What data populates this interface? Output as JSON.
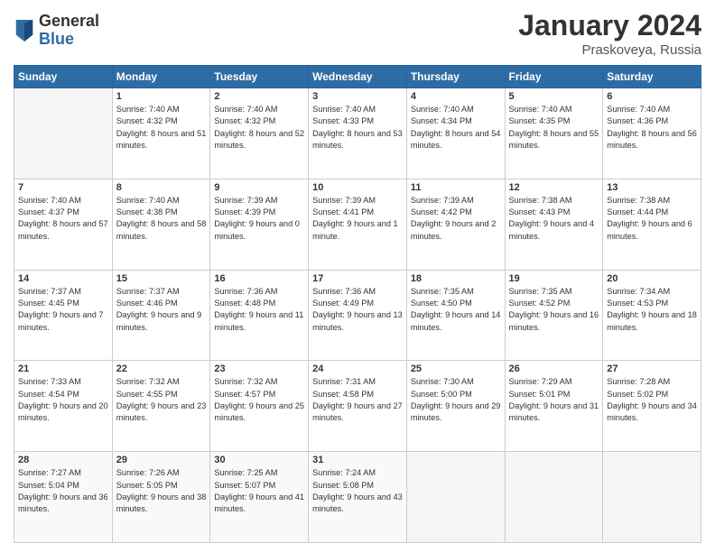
{
  "header": {
    "logo": {
      "general": "General",
      "blue": "Blue"
    },
    "title": "January 2024",
    "location": "Praskoveya, Russia"
  },
  "weekdays": [
    "Sunday",
    "Monday",
    "Tuesday",
    "Wednesday",
    "Thursday",
    "Friday",
    "Saturday"
  ],
  "weeks": [
    [
      {
        "day": "",
        "empty": true
      },
      {
        "day": "1",
        "sunrise": "Sunrise: 7:40 AM",
        "sunset": "Sunset: 4:32 PM",
        "daylight": "Daylight: 8 hours and 51 minutes."
      },
      {
        "day": "2",
        "sunrise": "Sunrise: 7:40 AM",
        "sunset": "Sunset: 4:32 PM",
        "daylight": "Daylight: 8 hours and 52 minutes."
      },
      {
        "day": "3",
        "sunrise": "Sunrise: 7:40 AM",
        "sunset": "Sunset: 4:33 PM",
        "daylight": "Daylight: 8 hours and 53 minutes."
      },
      {
        "day": "4",
        "sunrise": "Sunrise: 7:40 AM",
        "sunset": "Sunset: 4:34 PM",
        "daylight": "Daylight: 8 hours and 54 minutes."
      },
      {
        "day": "5",
        "sunrise": "Sunrise: 7:40 AM",
        "sunset": "Sunset: 4:35 PM",
        "daylight": "Daylight: 8 hours and 55 minutes."
      },
      {
        "day": "6",
        "sunrise": "Sunrise: 7:40 AM",
        "sunset": "Sunset: 4:36 PM",
        "daylight": "Daylight: 8 hours and 56 minutes."
      }
    ],
    [
      {
        "day": "7",
        "sunrise": "Sunrise: 7:40 AM",
        "sunset": "Sunset: 4:37 PM",
        "daylight": "Daylight: 8 hours and 57 minutes."
      },
      {
        "day": "8",
        "sunrise": "Sunrise: 7:40 AM",
        "sunset": "Sunset: 4:38 PM",
        "daylight": "Daylight: 8 hours and 58 minutes."
      },
      {
        "day": "9",
        "sunrise": "Sunrise: 7:39 AM",
        "sunset": "Sunset: 4:39 PM",
        "daylight": "Daylight: 9 hours and 0 minutes."
      },
      {
        "day": "10",
        "sunrise": "Sunrise: 7:39 AM",
        "sunset": "Sunset: 4:41 PM",
        "daylight": "Daylight: 9 hours and 1 minute."
      },
      {
        "day": "11",
        "sunrise": "Sunrise: 7:39 AM",
        "sunset": "Sunset: 4:42 PM",
        "daylight": "Daylight: 9 hours and 2 minutes."
      },
      {
        "day": "12",
        "sunrise": "Sunrise: 7:38 AM",
        "sunset": "Sunset: 4:43 PM",
        "daylight": "Daylight: 9 hours and 4 minutes."
      },
      {
        "day": "13",
        "sunrise": "Sunrise: 7:38 AM",
        "sunset": "Sunset: 4:44 PM",
        "daylight": "Daylight: 9 hours and 6 minutes."
      }
    ],
    [
      {
        "day": "14",
        "sunrise": "Sunrise: 7:37 AM",
        "sunset": "Sunset: 4:45 PM",
        "daylight": "Daylight: 9 hours and 7 minutes."
      },
      {
        "day": "15",
        "sunrise": "Sunrise: 7:37 AM",
        "sunset": "Sunset: 4:46 PM",
        "daylight": "Daylight: 9 hours and 9 minutes."
      },
      {
        "day": "16",
        "sunrise": "Sunrise: 7:36 AM",
        "sunset": "Sunset: 4:48 PM",
        "daylight": "Daylight: 9 hours and 11 minutes."
      },
      {
        "day": "17",
        "sunrise": "Sunrise: 7:36 AM",
        "sunset": "Sunset: 4:49 PM",
        "daylight": "Daylight: 9 hours and 13 minutes."
      },
      {
        "day": "18",
        "sunrise": "Sunrise: 7:35 AM",
        "sunset": "Sunset: 4:50 PM",
        "daylight": "Daylight: 9 hours and 14 minutes."
      },
      {
        "day": "19",
        "sunrise": "Sunrise: 7:35 AM",
        "sunset": "Sunset: 4:52 PM",
        "daylight": "Daylight: 9 hours and 16 minutes."
      },
      {
        "day": "20",
        "sunrise": "Sunrise: 7:34 AM",
        "sunset": "Sunset: 4:53 PM",
        "daylight": "Daylight: 9 hours and 18 minutes."
      }
    ],
    [
      {
        "day": "21",
        "sunrise": "Sunrise: 7:33 AM",
        "sunset": "Sunset: 4:54 PM",
        "daylight": "Daylight: 9 hours and 20 minutes."
      },
      {
        "day": "22",
        "sunrise": "Sunrise: 7:32 AM",
        "sunset": "Sunset: 4:55 PM",
        "daylight": "Daylight: 9 hours and 23 minutes."
      },
      {
        "day": "23",
        "sunrise": "Sunrise: 7:32 AM",
        "sunset": "Sunset: 4:57 PM",
        "daylight": "Daylight: 9 hours and 25 minutes."
      },
      {
        "day": "24",
        "sunrise": "Sunrise: 7:31 AM",
        "sunset": "Sunset: 4:58 PM",
        "daylight": "Daylight: 9 hours and 27 minutes."
      },
      {
        "day": "25",
        "sunrise": "Sunrise: 7:30 AM",
        "sunset": "Sunset: 5:00 PM",
        "daylight": "Daylight: 9 hours and 29 minutes."
      },
      {
        "day": "26",
        "sunrise": "Sunrise: 7:29 AM",
        "sunset": "Sunset: 5:01 PM",
        "daylight": "Daylight: 9 hours and 31 minutes."
      },
      {
        "day": "27",
        "sunrise": "Sunrise: 7:28 AM",
        "sunset": "Sunset: 5:02 PM",
        "daylight": "Daylight: 9 hours and 34 minutes."
      }
    ],
    [
      {
        "day": "28",
        "sunrise": "Sunrise: 7:27 AM",
        "sunset": "Sunset: 5:04 PM",
        "daylight": "Daylight: 9 hours and 36 minutes."
      },
      {
        "day": "29",
        "sunrise": "Sunrise: 7:26 AM",
        "sunset": "Sunset: 5:05 PM",
        "daylight": "Daylight: 9 hours and 38 minutes."
      },
      {
        "day": "30",
        "sunrise": "Sunrise: 7:25 AM",
        "sunset": "Sunset: 5:07 PM",
        "daylight": "Daylight: 9 hours and 41 minutes."
      },
      {
        "day": "31",
        "sunrise": "Sunrise: 7:24 AM",
        "sunset": "Sunset: 5:08 PM",
        "daylight": "Daylight: 9 hours and 43 minutes."
      },
      {
        "day": "",
        "empty": true
      },
      {
        "day": "",
        "empty": true
      },
      {
        "day": "",
        "empty": true
      }
    ]
  ]
}
